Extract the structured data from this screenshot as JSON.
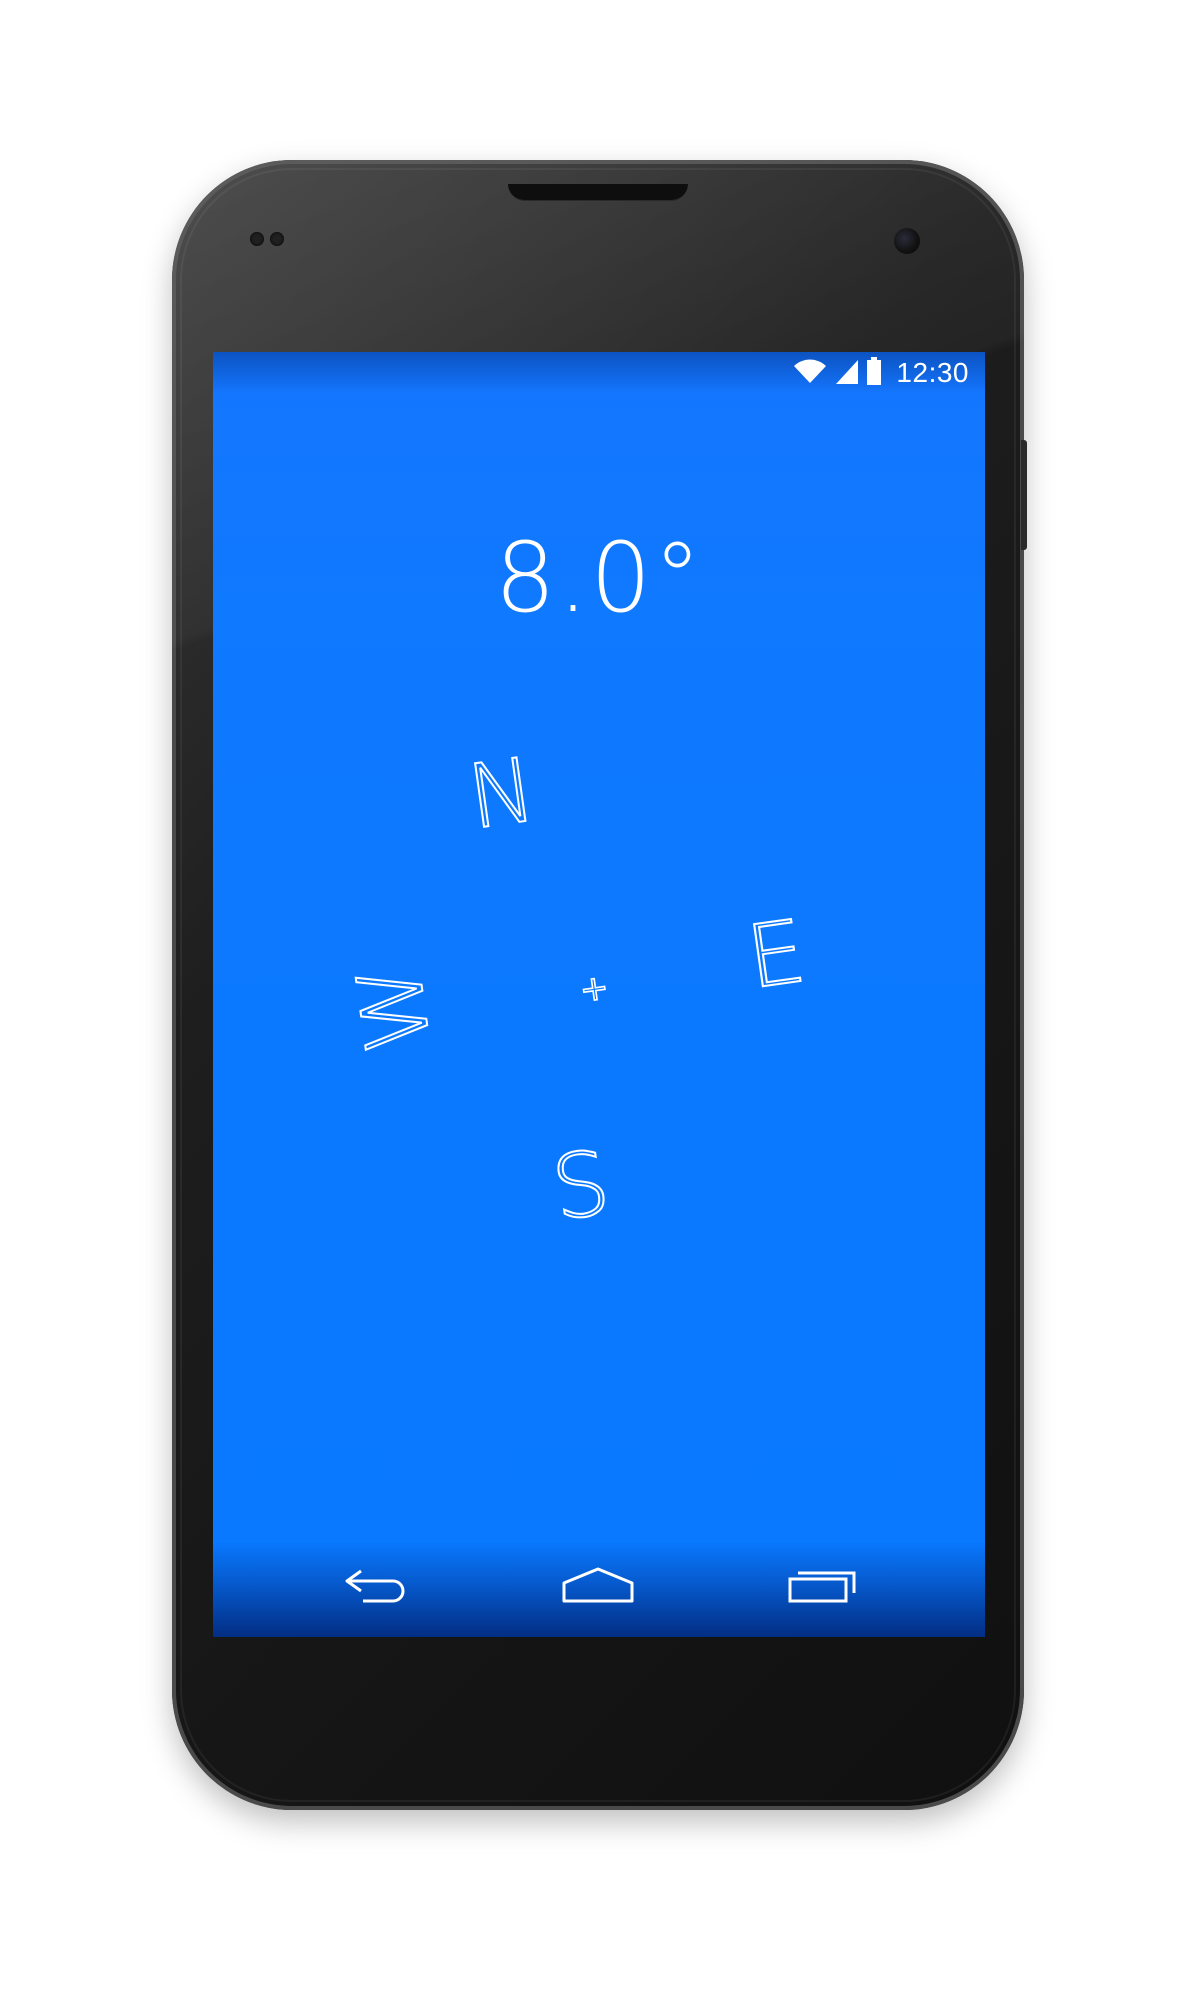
{
  "device": {
    "model": "Nexus 4 style phone"
  },
  "status_bar": {
    "time": "12:30",
    "icons": [
      "wifi-icon",
      "cell-signal-icon",
      "battery-icon"
    ]
  },
  "compass": {
    "heading": "8.0°",
    "north_label": "N",
    "east_label": "E",
    "south_label": "S",
    "west_label": "W",
    "center_label": "+"
  },
  "navigation_bar": {
    "buttons": [
      "back-icon",
      "home-icon",
      "recents-icon"
    ]
  },
  "colors": {
    "screen_background": "#0979ff",
    "foreground": "#ffffff",
    "phone_body": "#151515"
  }
}
